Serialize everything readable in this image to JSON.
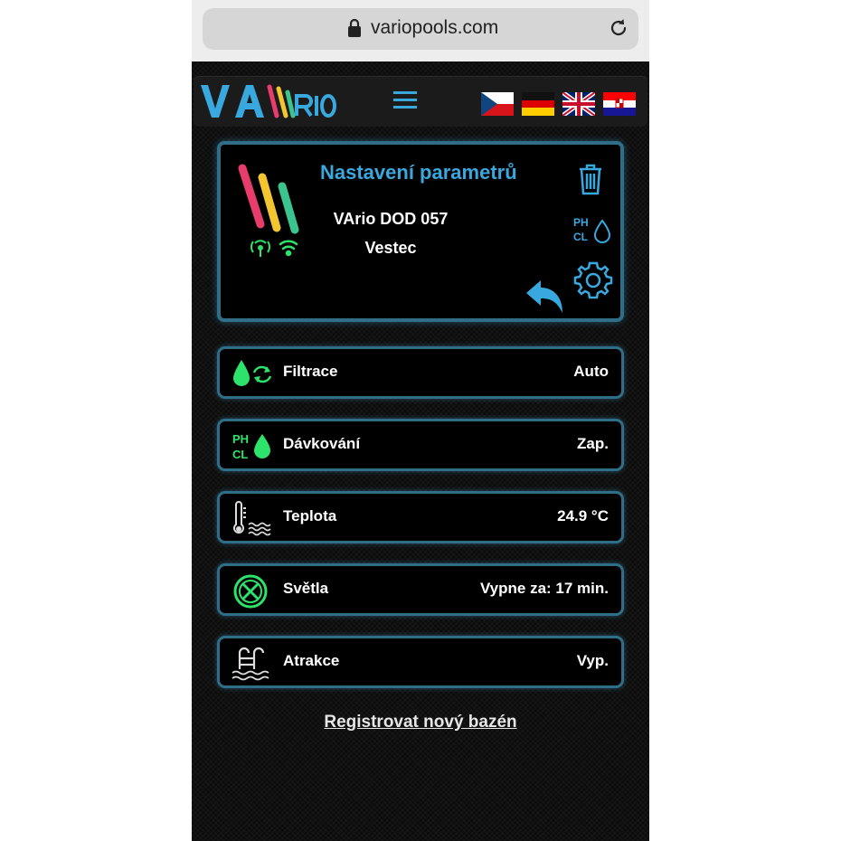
{
  "browser": {
    "url": "variopools.com"
  },
  "header": {
    "logo_icon": "vario-logo-icon",
    "menu_icon": "hamburger-menu-icon",
    "languages": [
      {
        "code": "cz",
        "icon": "flag-cz-icon"
      },
      {
        "code": "de",
        "icon": "flag-de-icon"
      },
      {
        "code": "en",
        "icon": "flag-uk-icon"
      },
      {
        "code": "hr",
        "icon": "flag-hr-icon"
      }
    ]
  },
  "device_card": {
    "title": "Nastavení parametrů",
    "device_name": "VArio DOD 057",
    "location": "Vestec",
    "phcl_ph": "PH",
    "phcl_cl": "CL"
  },
  "rows": [
    {
      "label": "Filtrace",
      "value": "Auto",
      "icon": "filtration-icon"
    },
    {
      "label": "Dávkování",
      "value": "Zap.",
      "icon": "dosing-ph-cl-icon",
      "icon_ph": "PH",
      "icon_cl": "CL"
    },
    {
      "label": "Teplota",
      "value": "24.9 °C",
      "icon": "thermometer-icon"
    },
    {
      "label": "Světla",
      "value": "Vypne za: 17 min.",
      "icon": "light-icon"
    },
    {
      "label": "Atrakce",
      "value": "Vyp.",
      "icon": "pool-ladder-icon"
    }
  ],
  "register_link": "Registrovat nový bazén",
  "colors": {
    "accent_blue": "#38a8de",
    "border_blue": "#2f6e86",
    "status_green": "#2ee36b",
    "background": "#0b0b0b"
  }
}
